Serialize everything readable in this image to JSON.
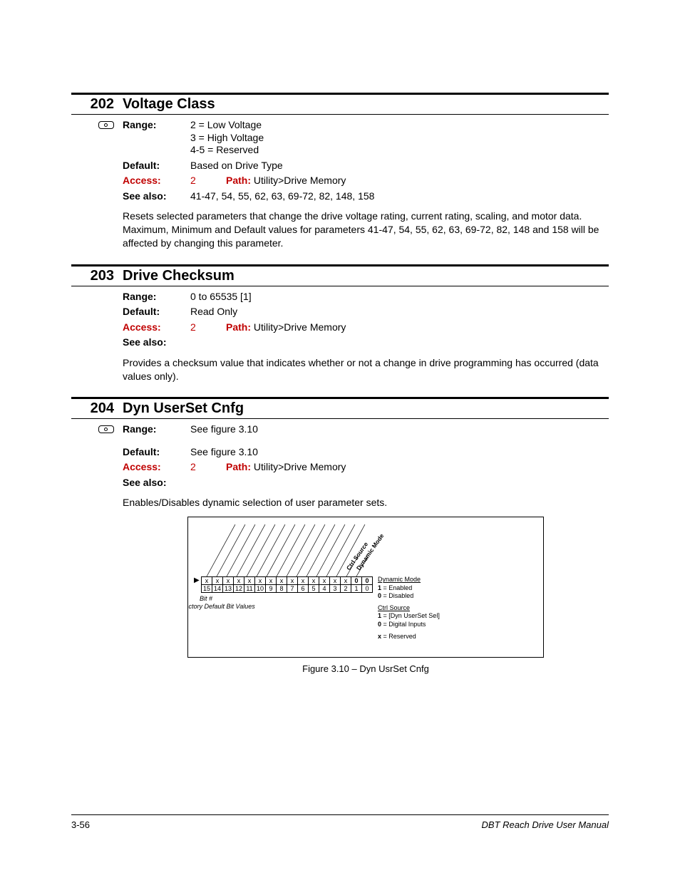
{
  "parameters": [
    {
      "num": "202",
      "title": "Voltage Class",
      "indicator": true,
      "range_lines": [
        "2 = Low Voltage",
        "3 = High Voltage",
        "4-5 = Reserved"
      ],
      "default": "Based on Drive Type",
      "access": "2",
      "path_label": "Path:",
      "path_value": "Utility>Drive Memory",
      "see_also": "41-47, 54, 55, 62, 63, 69-72, 82, 148, 158",
      "description": "Resets selected parameters that change the drive voltage rating, current rating, scaling, and motor data. Maximum, Minimum and Default values for parameters 41-47, 54, 55, 62, 63, 69-72, 82, 148 and 158 will be affected by changing this parameter."
    },
    {
      "num": "203",
      "title": "Drive Checksum",
      "indicator": false,
      "range_lines": [
        "0 to 65535 [1]"
      ],
      "default": "Read Only",
      "access": "2",
      "path_label": "Path:",
      "path_value": "Utility>Drive Memory",
      "see_also": "",
      "description": "Provides a checksum value that indicates whether or not a change in drive programming has occurred (data values only)."
    },
    {
      "num": "204",
      "title": "Dyn UserSet Cnfg",
      "indicator": true,
      "range_lines": [
        "See figure 3.10"
      ],
      "default": "See figure 3.10",
      "access": "2",
      "path_label": "Path:",
      "path_value": "Utility>Drive Memory",
      "see_also": "",
      "description": "Enables/Disables dynamic selection of user parameter sets."
    }
  ],
  "labels": {
    "range": "Range:",
    "default": "Default:",
    "access": "Access:",
    "see_also": "See also:"
  },
  "figure": {
    "caption": "Figure 3.10 – Dyn UsrSet Cnfg",
    "bit_hash": "Bit #",
    "factory_default": "Factory Default Bit Values",
    "bit_values": [
      "x",
      "x",
      "x",
      "x",
      "x",
      "x",
      "x",
      "x",
      "x",
      "x",
      "x",
      "x",
      "x",
      "x",
      "0",
      "0"
    ],
    "bit_numbers": [
      "15",
      "14",
      "13",
      "12",
      "11",
      "10",
      "9",
      "8",
      "7",
      "6",
      "5",
      "4",
      "3",
      "2",
      "1",
      "0"
    ],
    "rot_labels": [
      "Ctrl Source",
      "Dynamic Mode"
    ],
    "legend": [
      {
        "hdr": "Dynamic Mode",
        "rows": [
          {
            "k": "1",
            "v": "= Enabled"
          },
          {
            "k": "0",
            "v": "= Disabled"
          }
        ]
      },
      {
        "hdr": "Ctrl Source",
        "rows": [
          {
            "k": "1",
            "v": "= [Dyn UserSet Sel]"
          },
          {
            "k": "0",
            "v": "= Digital Inputs"
          }
        ]
      },
      {
        "hdr": "",
        "rows": [
          {
            "k": "x",
            "v": "= Reserved"
          }
        ]
      }
    ]
  },
  "footer": {
    "page": "3-56",
    "manual": "DBT Reach Drive User Manual"
  }
}
